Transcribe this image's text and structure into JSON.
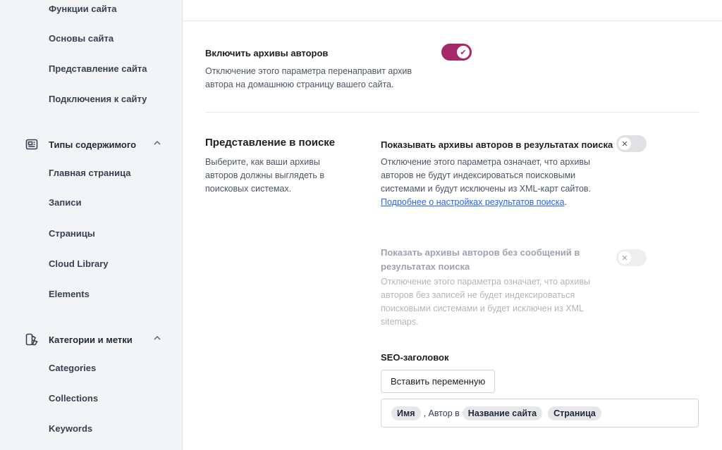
{
  "sidebar": {
    "top_items": [
      "Функции сайта",
      "Основы сайта",
      "Представление сайта",
      "Подключения к сайту"
    ],
    "groups": [
      {
        "label": "Типы содержимого",
        "icon": "content-types-icon",
        "items": [
          "Главная страница",
          "Записи",
          "Страницы",
          "Cloud Library",
          "Elements"
        ]
      },
      {
        "label": "Категории и метки",
        "icon": "taxonomies-icon",
        "items": [
          "Categories",
          "Collections",
          "Keywords"
        ]
      }
    ]
  },
  "main": {
    "author_archives": {
      "label": "Включить архивы авторов",
      "description": "Отключение этого параметра перенаправит архив автора на домашнюю страницу вашего сайта.",
      "enabled": true
    },
    "search_section": {
      "title": "Представление в поиске",
      "description": "Выберите, как ваши архивы авторов должны выглядеть в поисковых системах.",
      "show_in_results": {
        "label": "Показывать архивы авторов в результатах поиска",
        "description": "Отключение этого параметра означает, что архивы авторов не будут индексироваться поисковыми системами и будут исключены из XML-карт сайтов.",
        "link_text": "Подробнее о настройках результатов поиска",
        "after_link": ".",
        "enabled": false
      },
      "show_without_posts": {
        "label": "Показать архивы авторов без сообщений в результатах поиска",
        "description": "Отключение этого параметра означает, что архивы авторов без записей не будет индексироваться поисковыми системами и будет исключен из XML sitemaps.",
        "enabled": false
      },
      "seo_title": {
        "label": "SEO-заголовок",
        "insert_button": "Вставить переменную",
        "tokens": [
          {
            "type": "chip",
            "text": "Имя"
          },
          {
            "type": "text",
            "text": ", Автор в"
          },
          {
            "type": "chip",
            "text": "Название сайта"
          },
          {
            "type": "chip",
            "text": "Страница"
          }
        ]
      }
    }
  },
  "colors": {
    "accent": "#a4286a",
    "link": "#2563eb",
    "toggle_off": "#dfe1e5"
  },
  "toggle_glyphs": {
    "on": "✔",
    "off": "✕"
  }
}
